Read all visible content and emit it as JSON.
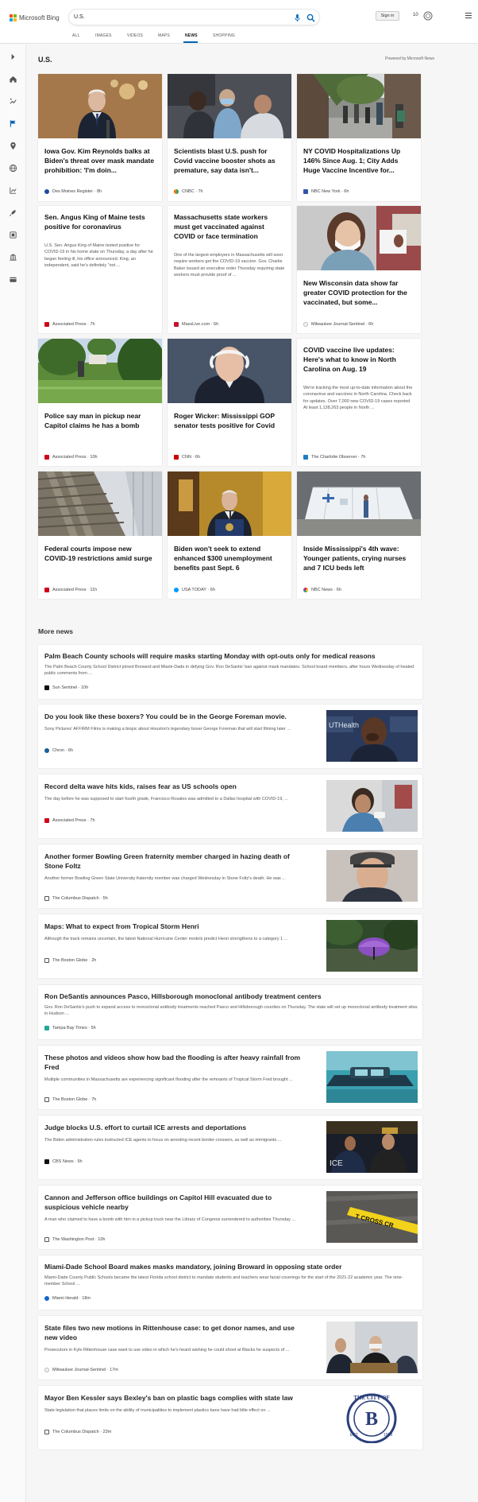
{
  "brand": {
    "logo_text": "Microsoft Bing"
  },
  "search": {
    "query": "U.S."
  },
  "header": {
    "sign_in": "Sign in",
    "points": "10"
  },
  "tabs": [
    {
      "label": "ALL"
    },
    {
      "label": "IMAGES"
    },
    {
      "label": "VIDEOS"
    },
    {
      "label": "MAPS"
    },
    {
      "label": "NEWS",
      "active": true
    },
    {
      "label": "SHOPPING"
    }
  ],
  "sidebar": {
    "icons": [
      "chevron-right-icon",
      "home-icon",
      "trending-icon",
      "flag-icon",
      "location-pin-icon",
      "globe-icon",
      "chart-icon",
      "rocket-icon",
      "film-icon",
      "building-icon",
      "wallet-icon"
    ]
  },
  "section": {
    "title": "U.S.",
    "powered_by": "Powered by Microsoft News"
  },
  "cards": [
    {
      "headline": "Iowa Gov. Kim Reynolds balks at Biden's threat over mask mandate prohibition: 'I'm doin...",
      "snippet": "",
      "source": "Des Moines Register",
      "age": "8h"
    },
    {
      "headline": "Scientists blast U.S. push for Covid vaccine booster shots as premature, say data isn't...",
      "snippet": "",
      "source": "CNBC",
      "age": "7h"
    },
    {
      "headline": "NY COVID Hospitalizations Up 146% Since Aug. 1; City Adds Huge Vaccine Incentive for...",
      "snippet": "",
      "source": "NBC New York",
      "age": "6h"
    },
    {
      "headline": "Sen. Angus King of Maine tests positive for coronavirus",
      "snippet": "U.S. Sen. Angus King of Maine tested positive for COVID-19 in his home state on Thursday, a day after he began feeling ill, his office announced. King, an independent, said he's definitely \"not ...",
      "source": "Associated Press",
      "age": "7h"
    },
    {
      "headline": "Massachusetts state workers must get vaccinated against COVID or face termination",
      "snippet": "One of the largest employers in Massachusetts will soon require workers get the COVID-19 vaccine. Gov. Charlie Baker issued an executive order Thursday requiring state workers must provide proof of ...",
      "source": "MassLive.com",
      "age": "6h"
    },
    {
      "headline": "New Wisconsin data show far greater COVID protection for the vaccinated, but some...",
      "snippet": "",
      "source": "Milwaukee Journal-Sentinel",
      "age": "6h"
    },
    {
      "headline": "Police say man in pickup near Capitol claims he has a bomb",
      "snippet": "",
      "source": "Associated Press",
      "age": "10h"
    },
    {
      "headline": "Roger Wicker: Mississippi GOP senator tests positive for Covid",
      "snippet": "",
      "source": "CNN",
      "age": "6h"
    },
    {
      "headline": "COVID vaccine live updates: Here's what to know in North Carolina on Aug. 19",
      "snippet": "We're tracking the most up-to-date information about the coronavirus and vaccines in North Carolina. Check back for updates. Over 7,000 new COVID-19 cases reported At least 1,138,263 people in North ...",
      "source": "The Charlotte Observer",
      "age": "7h"
    },
    {
      "headline": "Federal courts impose new COVID-19 restrictions amid surge",
      "snippet": "",
      "source": "Associated Press",
      "age": "11h"
    },
    {
      "headline": "Biden won't seek to extend enhanced $300 unemployment benefits past Sept. 6",
      "snippet": "",
      "source": "USA TODAY",
      "age": "6h"
    },
    {
      "headline": "Inside Mississippi's 4th wave: Younger patients, crying nurses and 7 ICU beds left",
      "snippet": "",
      "source": "NBC News",
      "age": "6h"
    }
  ],
  "more_news": {
    "title": "More news",
    "items": [
      {
        "headline": "Palm Beach County schools will require masks starting Monday with opt-outs only for medical reasons",
        "snippet": "The Palm Beach County School District joined Broward and Miami-Dade in defying Gov. Ron DeSantis' ban against mask mandates. School board members, after hours Wednesday of heated public comments from ...",
        "source": "Sun Sentinel",
        "age": "10h"
      },
      {
        "headline": "Do you look like these boxers? You could be in the George Foreman movie.",
        "snippet": "Sony Pictures' AFFIRM Films is making a biopic about Houston's legendary boxer George Foreman that will start filming later ...",
        "source": "Chron",
        "age": "6h"
      },
      {
        "headline": "Record delta wave hits kids, raises fear as US schools open",
        "snippet": "The day before he was supposed to start fourth grade, Francisco Rosales was admitted to a Dallas hospital with COVID-19, ...",
        "source": "Associated Press",
        "age": "7h"
      },
      {
        "headline": "Another former Bowling Green fraternity member charged in hazing death of Stone Foltz",
        "snippet": "Another former Bowling Green State University fraternity member was charged Wednesday in Stone Foltz's death. He was ...",
        "source": "The Columbus Dispatch",
        "age": "5h"
      },
      {
        "headline": "Maps: What to expect from Tropical Storm Henri",
        "snippet": "Although the track remains uncertain, the latest National Hurricane Center models predict Henri strengthens to a category 1 ...",
        "source": "The Boston Globe",
        "age": "2h"
      },
      {
        "headline": "Ron DeSantis announces Pasco, Hillsborough monoclonal antibody treatment centers",
        "snippet": "Gov. Ron DeSantis's push to expand access to monoclonal antibody treatments reached Pasco and Hillsborough counties on Thursday. The state will set up monoclonal antibody treatment sites in Hudson ...",
        "source": "Tampa Bay Times",
        "age": "5h"
      },
      {
        "headline": "These photos and videos show how bad the flooding is after heavy rainfall from Fred",
        "snippet": "Multiple communities in Massachusetts are experiencing significant flooding after the remnants of Tropical Storm Fred brought ...",
        "source": "The Boston Globe",
        "age": "7h"
      },
      {
        "headline": "Judge blocks U.S. effort to curtail ICE arrests and deportations",
        "snippet": "The Biden administration rules instructed ICE agents to focus on arresting recent border-crossers, as well as immigrants ...",
        "source": "CBS News",
        "age": "5h"
      },
      {
        "headline": "Cannon and Jefferson office buildings on Capitol Hill evacuated due to suspicious vehicle nearby",
        "snippet": "A man who claimed to have a bomb with him in a pickup truck near the Library of Congress surrendered to authorities Thursday ...",
        "source": "The Washington Post",
        "age": "10h"
      },
      {
        "headline": "Miami-Dade School Board makes masks mandatory, joining Broward in opposing state order",
        "snippet": "Miami-Dade County Public Schools became the latest Florida school district to mandate students and teachers wear facial coverings for the start of the 2021-22 academic year. The nine-member School ...",
        "source": "Miami Herald",
        "age": "18m"
      },
      {
        "headline": "State files two new motions in Rittenhouse case: to get donor names, and use new video",
        "snippet": "Prosecutors in Kyle Rittenhouse case want to use video in which he's heard wishing he could shoot at Blacks he suspects of ...",
        "source": "Milwaukee Journal-Sentinel",
        "age": "17m"
      },
      {
        "headline": "Mayor Ben Kessler says Bexley's ban on plastic bags complies with state law",
        "snippet": "State legislation that places limits on the ability of municipalities to implement plastics bans have had little effect on ...",
        "source": "The Columbus Dispatch",
        "age": "23m"
      }
    ]
  },
  "thumb_texts": {
    "cross_tape": "T CROSS CR",
    "seal_top": "THE CITY OF",
    "seal_est": "EST.",
    "seal_year": "1908",
    "uth": "UTHealth"
  },
  "colors": {
    "accent": "#0067b8",
    "bing_teal": "#008373"
  }
}
